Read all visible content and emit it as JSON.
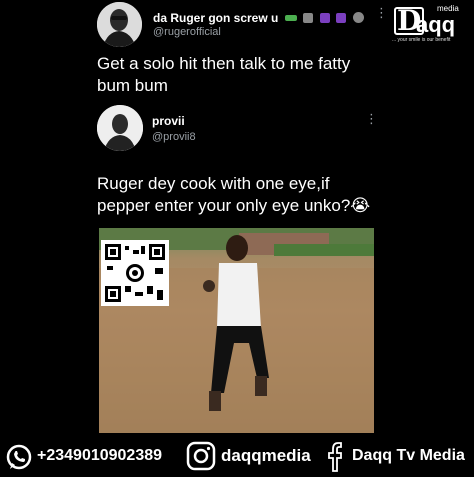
{
  "post": {
    "author_name": "da Ruger gon screw u",
    "author_handle": "@rugerofficial",
    "text": "Get a solo hit then talk to me fatty bum bum"
  },
  "reply": {
    "author_name": "provii",
    "author_handle": "@provii8",
    "text": "Ruger dey cook with one eye,if pepper enter your only eye unko?😭"
  },
  "watermark": {
    "brand": "aqq",
    "brand_initial": "D",
    "media_label": "media",
    "tagline": "... your smile is our benefit"
  },
  "footer": {
    "phone": "+2349010902389",
    "instagram": "daqqmedia",
    "facebook": "Daqq Tv Media"
  },
  "icons": [
    "more-icon",
    "whatsapp-icon",
    "instagram-icon",
    "facebook-icon",
    "qr-code-icon",
    "verified-badge-icon"
  ],
  "colors": {
    "background": "#000000",
    "text": "#ffffff",
    "muted": "#9aa0a6"
  }
}
